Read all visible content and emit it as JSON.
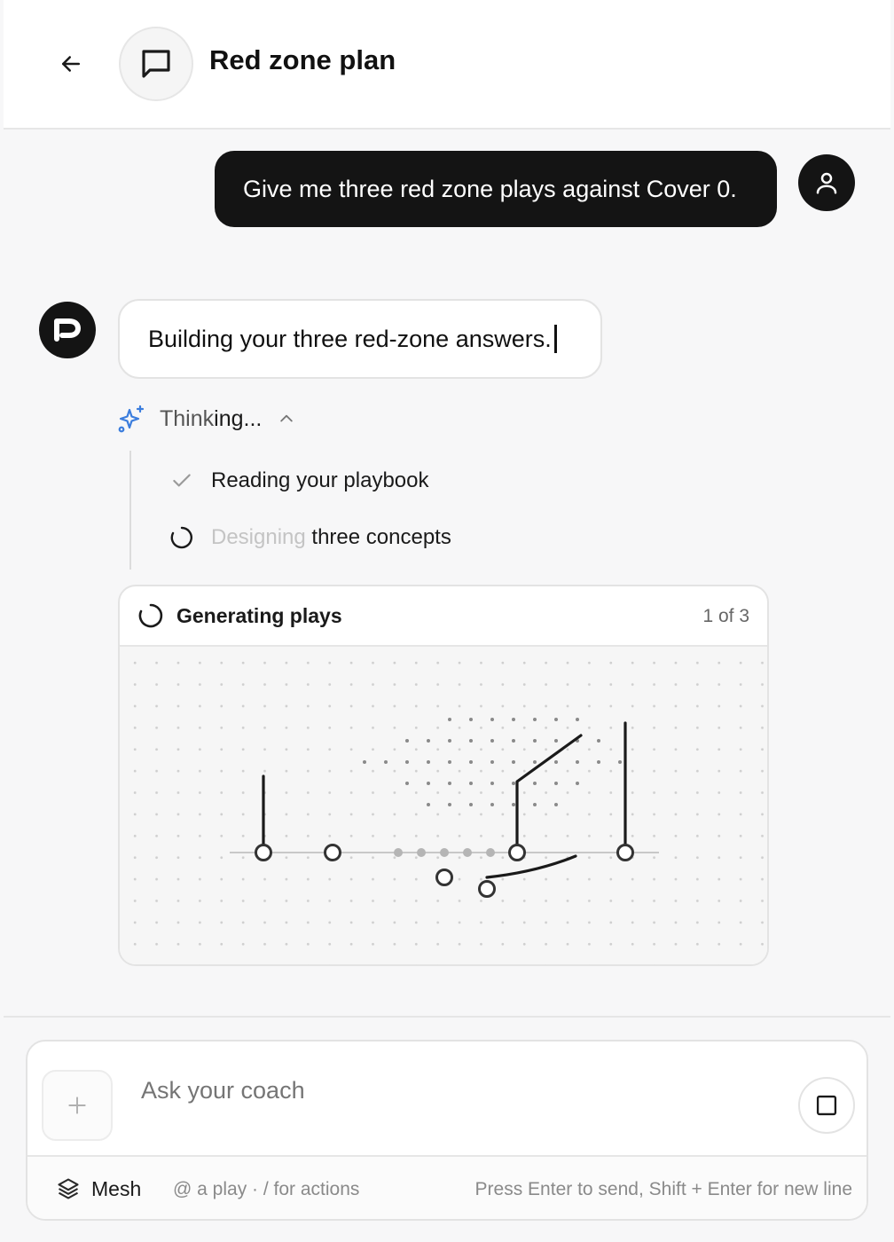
{
  "header": {
    "title": "Red zone plan",
    "back_icon": "arrow-left-icon",
    "chat_icon": "message-square-icon"
  },
  "messages": {
    "user": {
      "text": "Give me three red zone plays against Cover 0.",
      "avatar_icon": "user-icon"
    },
    "assistant": {
      "text": "Building your three red-zone answers.",
      "avatar_icon": "p-logo-icon"
    }
  },
  "thinking": {
    "label_start": "Think",
    "label_end": "ing...",
    "icon": "sparkles-icon",
    "steps": [
      {
        "status": "done",
        "icon": "check-icon",
        "text": "Reading your playbook"
      },
      {
        "status": "active",
        "icon": "spinner-icon",
        "text_dim": "Designing",
        "text": " three concepts"
      }
    ]
  },
  "generation_card": {
    "title": "Generating plays",
    "count": "1 of 3",
    "icon": "spinner-icon"
  },
  "composer": {
    "placeholder": "Ask your coach",
    "add_icon": "plus-icon",
    "stop_icon": "stop-square-icon",
    "mesh_label": "Mesh",
    "mesh_icon": "layers-icon",
    "hint_left": "@ a play · / for actions",
    "hint_right": "Press Enter to send, Shift + Enter for new line"
  },
  "colors": {
    "accent_blue": "#3b7ddd",
    "dark": "#141414",
    "background": "#f7f7f8"
  }
}
